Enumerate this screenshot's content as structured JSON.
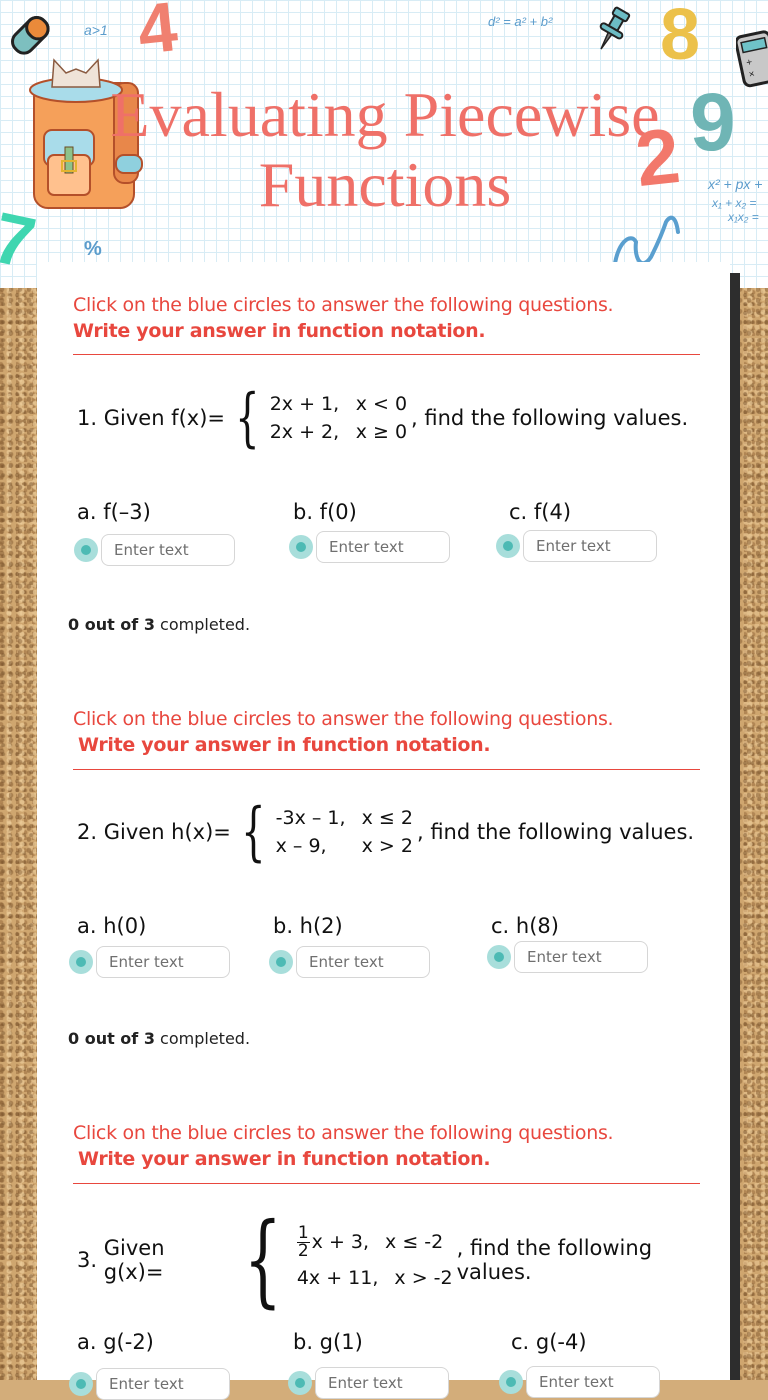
{
  "header": {
    "title_line1": "Evaluating Piecewise",
    "title_line2": "Functions",
    "doodles": {
      "a_gt_1": "a>1",
      "pythag": "d² = a² + b²",
      "quadratic": "x² + px +",
      "vieta1": "x₁ + x₂ =",
      "vieta2": "x₁x₂ =",
      "percent": "%",
      "num4": "4",
      "num8": "8",
      "num9": "9",
      "num2": "2",
      "num7": "7"
    }
  },
  "instructions": {
    "line1": "Click on the blue circles to answer the following questions.",
    "line2": "Write your answer in function notation."
  },
  "questions": [
    {
      "number": "1.",
      "prefix": "Given f(x)=",
      "pieces": [
        {
          "expr": "2x + 1,",
          "cond": "x < 0"
        },
        {
          "expr": "2x + 2,",
          "cond": "x ≥ 0"
        }
      ],
      "suffix": ", find the following values.",
      "parts": [
        {
          "label": "a.  f(–3)",
          "placeholder": "Enter text",
          "value": ""
        },
        {
          "label": "b.  f(0)",
          "placeholder": "Enter text",
          "value": ""
        },
        {
          "label": "c.  f(4)",
          "placeholder": "Enter text",
          "value": ""
        }
      ],
      "progress_bold": "0 out of 3",
      "progress_rest": " completed."
    },
    {
      "number": "2.",
      "prefix": "Given h(x)=",
      "pieces": [
        {
          "expr": "-3x – 1,",
          "cond": "x ≤ 2"
        },
        {
          "expr": "x – 9,",
          "cond": "x > 2"
        }
      ],
      "suffix": ", find the following values.",
      "parts": [
        {
          "label": "a.  h(0)",
          "placeholder": "Enter text",
          "value": ""
        },
        {
          "label": "b.  h(2)",
          "placeholder": "Enter text",
          "value": ""
        },
        {
          "label": "c.  h(8)",
          "placeholder": "Enter text",
          "value": ""
        }
      ],
      "progress_bold": "0 out of 3",
      "progress_rest": " completed."
    },
    {
      "number": "3.",
      "prefix": "Given g(x)=",
      "pieces": [
        {
          "frac_num": "1",
          "frac_den": "2",
          "expr": "x + 3,",
          "cond": "x ≤ -2"
        },
        {
          "expr": "4x + 11,",
          "cond": "x > -2"
        }
      ],
      "suffix": ", find the following values.",
      "parts": [
        {
          "label": "a.  g(-2)",
          "placeholder": "Enter text",
          "value": ""
        },
        {
          "label": "b.  g(1)",
          "placeholder": "Enter text",
          "value": ""
        },
        {
          "label": "c.  g(-4)",
          "placeholder": "Enter text",
          "value": ""
        }
      ]
    }
  ],
  "colors": {
    "title": "#ef7068",
    "instruction": "#e8473e",
    "radio_outer": "#a8dedb",
    "radio_inner": "#4dbab4"
  }
}
